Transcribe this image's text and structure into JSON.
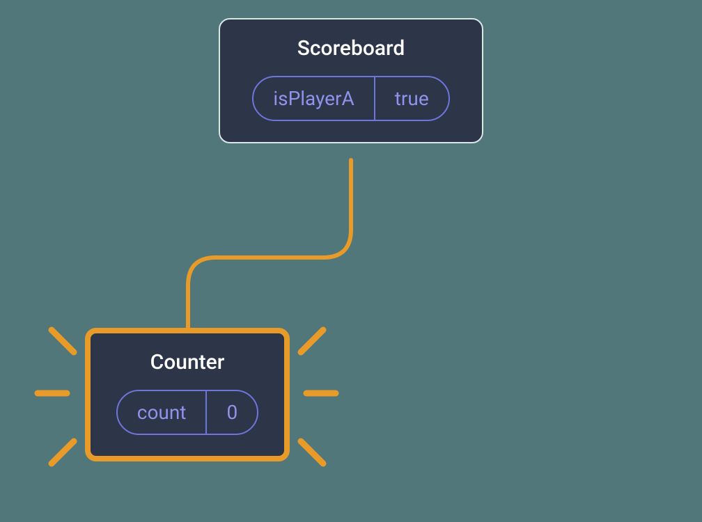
{
  "nodes": {
    "scoreboard": {
      "title": "Scoreboard",
      "state": {
        "key": "isPlayerA",
        "value": "true"
      },
      "highlighted": false
    },
    "counter": {
      "title": "Counter",
      "state": {
        "key": "count",
        "value": "0"
      },
      "highlighted": true
    }
  },
  "connections": [
    {
      "from": "scoreboard",
      "to": "counter"
    }
  ],
  "colors": {
    "background": "#52777a",
    "node_fill": "#2d3548",
    "node_border": "#dbe6e6",
    "highlight": "#e99b29",
    "pill_border": "#7075db",
    "pill_text": "#8f93ec",
    "title_text": "#ffffff"
  }
}
